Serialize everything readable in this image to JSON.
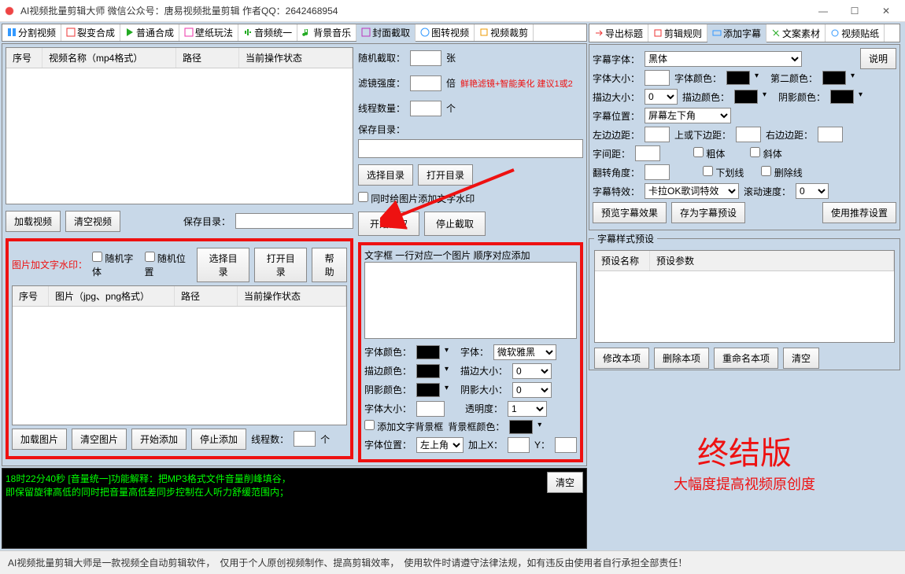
{
  "title": "AI视频批量剪辑大师    微信公众号：唐易视频批量剪辑    作者QQ：2642468954",
  "win": {
    "min": "—",
    "max": "☐",
    "close": "✕"
  },
  "left_tabs": [
    "分割视频",
    "裂变合成",
    "普通合成",
    "壁纸玩法",
    "音频统一",
    "背景音乐",
    "封面截取",
    "图转视频",
    "视频裁剪"
  ],
  "right_tabs": [
    "导出标题",
    "剪辑规则",
    "添加字幕",
    "文案素材",
    "视频贴纸"
  ],
  "video_grid": {
    "h1": "序号",
    "h2": "视频名称（mp4格式）",
    "h3": "路径",
    "h4": "当前操作状态"
  },
  "btns": {
    "load_video": "加载视频",
    "clear_video": "清空视频",
    "save_dir_lbl": "保存目录：",
    "choose_dir": "选择目录",
    "open_dir": "打开目录",
    "help": "帮助",
    "load_img": "加载图片",
    "clear_img": "清空图片",
    "start_add": "开始添加",
    "stop_add": "停止添加",
    "threads_lbl": "线程数：",
    "threads_unit": "个",
    "start_cap": "开始截取",
    "stop_cap": "停止截取",
    "clear_log": "清空"
  },
  "watermark": {
    "title": "图片加文字水印：",
    "rand_font": "随机字体",
    "rand_pos": "随机位置",
    "h1": "序号",
    "h2": "图片（jpg、png格式）",
    "h3": "路径",
    "h4": "当前操作状态"
  },
  "cover": {
    "rand_cap": "随机截取：",
    "unit_sheet": "张",
    "filter": "滤镜强度：",
    "unit_times": "倍",
    "hint": "鲜艳滤镜+智能美化 建议1或2",
    "threads": "线程数量：",
    "unit_count": "个",
    "save_dir": "保存目录：",
    "wm_check": "同时给图片添加文字水印",
    "textbox_hint": "文字框 一行对应一个图片 顺序对应添加",
    "font_color": "字体颜色：",
    "font": "字体：",
    "font_val": "微软雅黑",
    "stroke_color": "描边颜色：",
    "stroke_size": "描边大小：",
    "shadow_color": "阴影颜色：",
    "shadow_size": "阴影大小：",
    "font_size": "字体大小：",
    "opacity": "透明度：",
    "add_bg": "添加文字背景框",
    "bg_color": "背景框颜色：",
    "font_pos": "字体位置：",
    "pos_val": "左上角",
    "addx": "加上X：",
    "y": "Y："
  },
  "subtitle": {
    "explain": "说明",
    "font_family": "字幕字体：",
    "font_family_val": "黑体",
    "font_size": "字体大小：",
    "font_color": "字体颜色：",
    "color2": "第二颜色：",
    "stroke_size": "描边大小：",
    "stroke_val": "0",
    "stroke_color": "描边颜色：",
    "shadow_color": "阴影颜色：",
    "pos": "字幕位置：",
    "pos_val": "屏幕左下角",
    "left_margin": "左边边距：",
    "tb_margin": "上或下边距：",
    "right_margin": "右边边距：",
    "spacing": "字间距：",
    "bold": "粗体",
    "italic": "斜体",
    "angle": "翻转角度：",
    "underline": "下划线",
    "strike": "删除线",
    "effect": "字幕特效：",
    "effect_val": "卡拉OK歌词特效",
    "scroll": "滚动速度：",
    "scroll_val": "0",
    "preview": "预览字幕效果",
    "save_preset": "存为字幕预设",
    "use_rec": "使用推荐设置",
    "preset_group": "字幕样式预设",
    "preset_name": "预设名称",
    "preset_param": "预设参数",
    "mod": "修改本项",
    "del": "删除本项",
    "rename": "重命名本项",
    "clear": "清空"
  },
  "log": {
    "l1": "18时22分40秒 [音量统一]功能解释：把MP3格式文件音量削峰填谷，",
    "l2": "    即保留旋律高低的同时把音量高低差同步控制在人听力舒缓范围内；"
  },
  "endver": {
    "big": "终结版",
    "sub": "大幅度提高视频原创度"
  },
  "footer": "AI视频批量剪辑大师是一款视频全自动剪辑软件，　仅用于个人原创视频制作、提高剪辑效率，　使用软件时请遵守法律法规，如有违反由使用者自行承担全部责任！"
}
